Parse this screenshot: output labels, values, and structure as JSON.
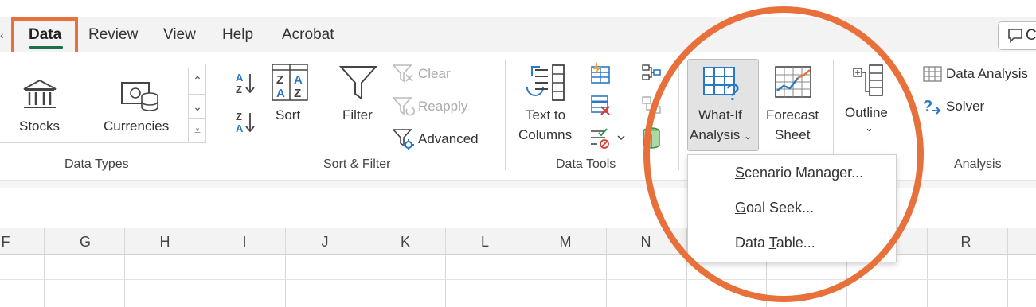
{
  "tabs": [
    {
      "label": "Data",
      "active": true
    },
    {
      "label": "Review",
      "active": false
    },
    {
      "label": "View",
      "active": false
    },
    {
      "label": "Help",
      "active": false
    },
    {
      "label": "Acrobat",
      "active": false
    }
  ],
  "data_types": {
    "stocks": "Stocks",
    "currencies": "Currencies",
    "group": "Data Types"
  },
  "sort_filter": {
    "sort": "Sort",
    "filter": "Filter",
    "clear": "Clear",
    "reapply": "Reapply",
    "advanced": "Advanced",
    "group": "Sort & Filter"
  },
  "data_tools": {
    "text_to_columns_1": "Text to",
    "text_to_columns_2": "Columns",
    "group": "Data Tools"
  },
  "forecast": {
    "whatif_1": "What-If",
    "whatif_2": "Analysis",
    "forecast_1": "Forecast",
    "forecast_2": "Sheet"
  },
  "outline": {
    "label": "Outline"
  },
  "analysis": {
    "data_analysis": "Data Analysis",
    "solver": "Solver",
    "group": "Analysis"
  },
  "whatif_menu": [
    {
      "pre": "",
      "key": "S",
      "post": "cenario Manager..."
    },
    {
      "pre": "",
      "key": "G",
      "post": "oal Seek..."
    },
    {
      "pre": "Data ",
      "key": "T",
      "post": "able..."
    }
  ],
  "columns": [
    "F",
    "G",
    "H",
    "I",
    "J",
    "K",
    "L",
    "M",
    "N",
    "R"
  ],
  "colors": {
    "accent": "#e8703a",
    "excel_green": "#1e7145",
    "icon_blue": "#2b78c6"
  }
}
